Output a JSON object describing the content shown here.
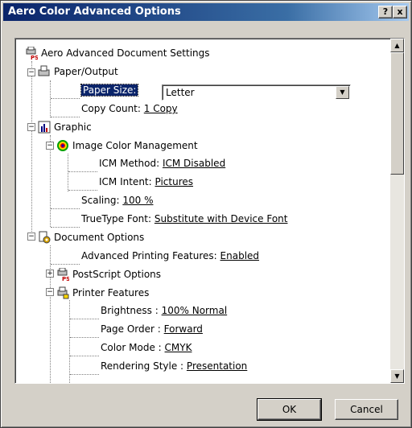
{
  "window": {
    "title": "Aero Color Advanced Options",
    "help_glyph": "?",
    "close_glyph": "x"
  },
  "tree": {
    "root_label": "Aero Advanced Document Settings",
    "paper_output": "Paper/Output",
    "paper_size_label": "Paper Size:",
    "paper_size_value": "Letter",
    "copy_count_label": "Copy Count:",
    "copy_count_value": "1 Copy",
    "graphic": "Graphic",
    "icm": "Image Color Management",
    "icm_method_label": "ICM Method:",
    "icm_method_value": "ICM Disabled",
    "icm_intent_label": "ICM Intent:",
    "icm_intent_value": "Pictures",
    "scaling_label": "Scaling:",
    "scaling_value": "100 %",
    "truetype_label": "TrueType Font:",
    "truetype_value": "Substitute with Device Font",
    "document_options": "Document Options",
    "adv_printing_label": "Advanced Printing Features:",
    "adv_printing_value": "Enabled",
    "postscript_options": "PostScript Options",
    "printer_features": "Printer Features",
    "brightness_label": "Brightness :",
    "brightness_value": "100% Normal",
    "page_order_label": "Page Order :",
    "page_order_value": "Forward",
    "color_mode_label": "Color Mode :",
    "color_mode_value": "CMYK",
    "rendering_label": "Rendering Style :",
    "rendering_value": "Presentation"
  },
  "buttons": {
    "ok": "OK",
    "cancel": "Cancel"
  },
  "colors": {
    "titlebar_start": "#0a246a",
    "face": "#d4d0c8",
    "selection": "#0a246a"
  }
}
